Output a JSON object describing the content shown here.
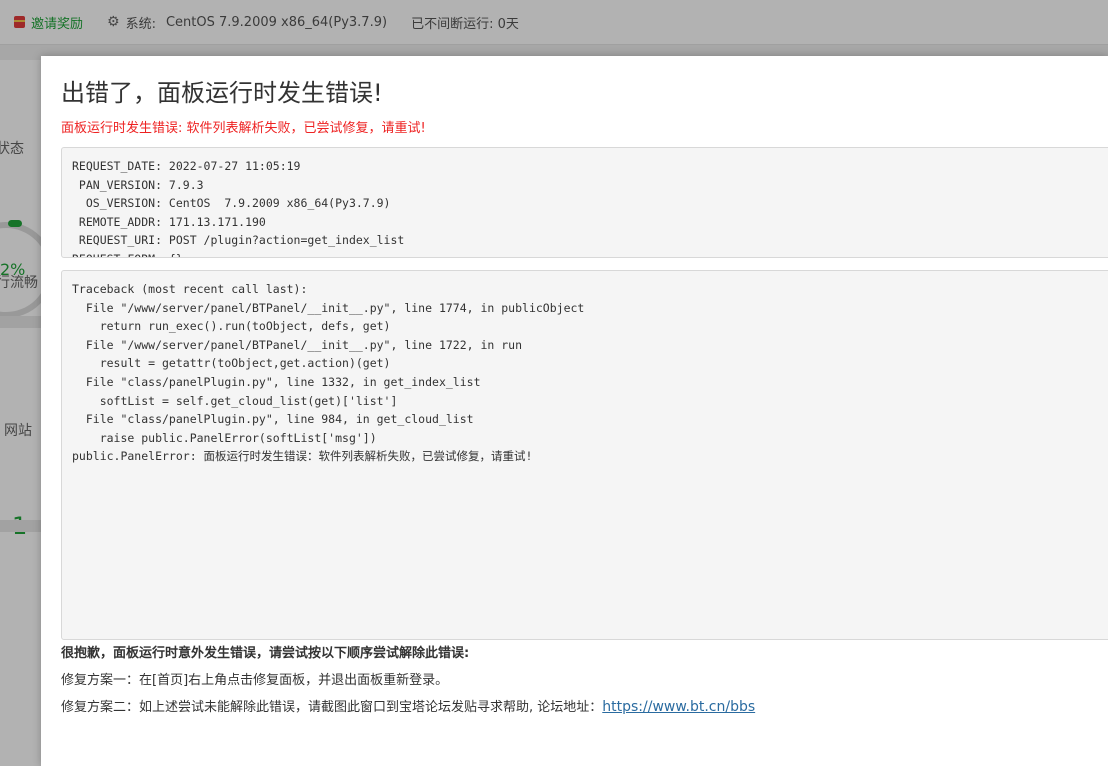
{
  "topbar": {
    "invite_label": "邀请奖励",
    "system_label": "系统:",
    "system_value": "CentOS 7.9.2009 x86_64(Py3.7.9)",
    "uptime": "已不间断运行: 0天"
  },
  "background": {
    "status_label": "状态",
    "load_value": "2%",
    "load_status": "行流畅",
    "site_label": "网站",
    "site_count": "1"
  },
  "modal": {
    "title": "出错了，面板运行时发生错误!",
    "error_message": "面板运行时发生错误: 软件列表解析失败，已尝试修复，请重试!",
    "info_lines": [
      "REQUEST_DATE: 2022-07-27 11:05:19",
      " PAN_VERSION: 7.9.3",
      "  OS_VERSION: CentOS  7.9.2009 x86_64(Py3.7.9)",
      " REMOTE_ADDR: 171.13.171.190",
      " REQUEST_URI: POST /plugin?action=get_index_list",
      "REQUEST_FORM: {}"
    ],
    "traceback_lines": [
      "Traceback (most recent call last):",
      "  File \"/www/server/panel/BTPanel/__init__.py\", line 1774, in publicObject",
      "    return run_exec().run(toObject, defs, get)",
      "  File \"/www/server/panel/BTPanel/__init__.py\", line 1722, in run",
      "    result = getattr(toObject,get.action)(get)",
      "  File \"class/panelPlugin.py\", line 1332, in get_index_list",
      "    softList = self.get_cloud_list(get)['list']",
      "  File \"class/panelPlugin.py\", line 984, in get_cloud_list",
      "    raise public.PanelError(softList['msg'])",
      "public.PanelError: 面板运行时发生错误：软件列表解析失败，已尝试修复，请重试!"
    ],
    "help_title": "很抱歉，面板运行时意外发生错误，请尝试按以下顺序尝试解除此错误:",
    "fix1": "修复方案一：在[首页]右上角点击修复面板，并退出面板重新登录。",
    "fix2": "修复方案二：如上述尝试未能解除此错误，请截图此窗口到宝塔论坛发贴寻求帮助, 论坛地址：",
    "forum_url": "https://www.bt.cn/bbs"
  }
}
